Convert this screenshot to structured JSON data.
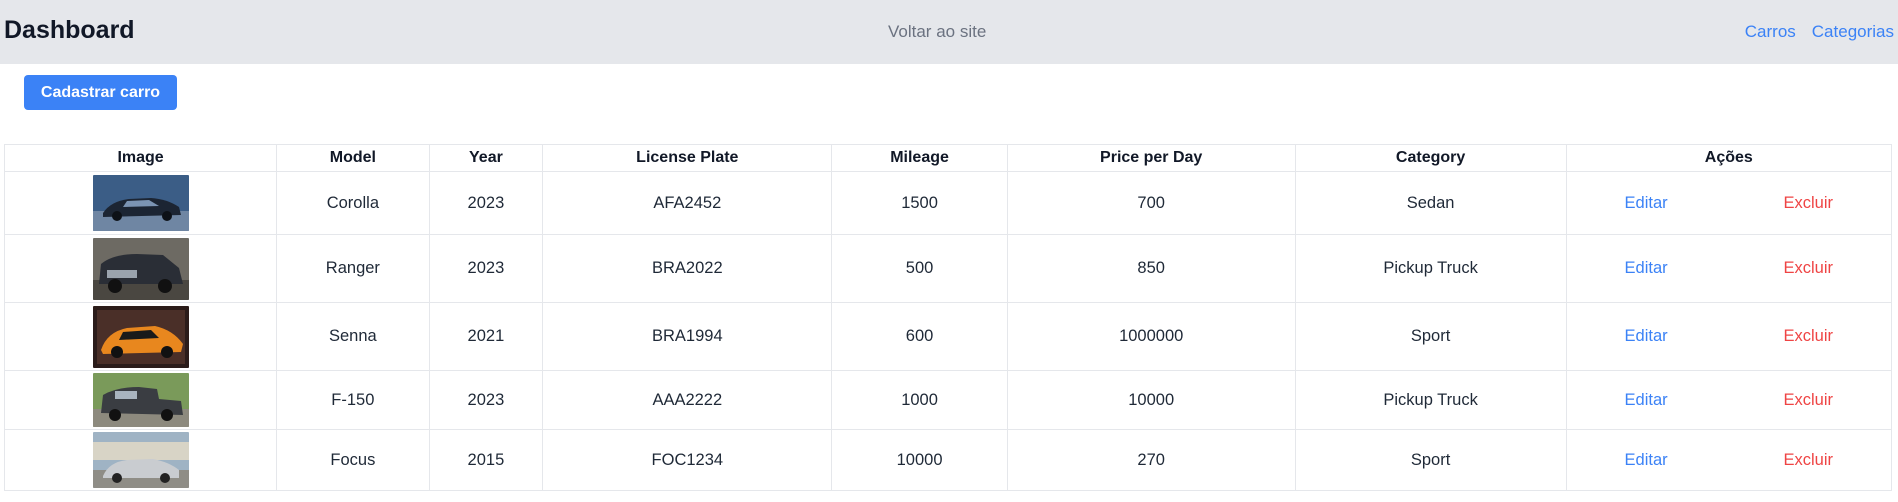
{
  "header": {
    "title": "Dashboard",
    "back_link": "Voltar ao site",
    "nav": [
      "Carros",
      "Categorias"
    ]
  },
  "actions": {
    "add_button": "Cadastrar carro"
  },
  "table": {
    "headers": [
      "Image",
      "Model",
      "Year",
      "License Plate",
      "Mileage",
      "Price per Day",
      "Category",
      "Ações"
    ],
    "edit_label": "Editar",
    "delete_label": "Excluir",
    "rows": [
      {
        "model": "Corolla",
        "year": "2023",
        "plate": "AFA2452",
        "mileage": "1500",
        "price": "700",
        "category": "Sedan"
      },
      {
        "model": "Ranger",
        "year": "2023",
        "plate": "BRA2022",
        "mileage": "500",
        "price": "850",
        "category": "Pickup Truck"
      },
      {
        "model": "Senna",
        "year": "2021",
        "plate": "BRA1994",
        "mileage": "600",
        "price": "1000000",
        "category": "Sport"
      },
      {
        "model": "F-150",
        "year": "2023",
        "plate": "AAA2222",
        "mileage": "1000",
        "price": "10000",
        "category": "Pickup Truck"
      },
      {
        "model": "Focus",
        "year": "2015",
        "plate": "FOC1234",
        "mileage": "10000",
        "price": "270",
        "category": "Sport"
      }
    ]
  },
  "colors": {
    "primary": "#3b82f6",
    "danger": "#ef4444",
    "header_bg": "#e5e7eb"
  }
}
